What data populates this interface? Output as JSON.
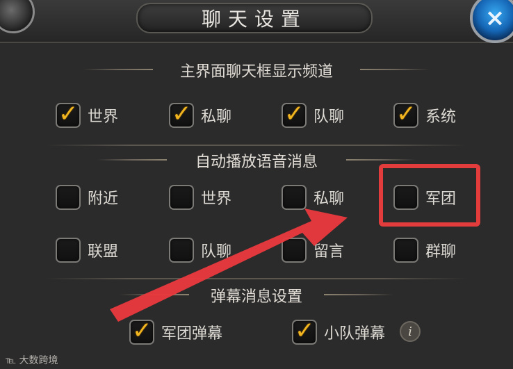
{
  "window": {
    "title": "聊天设置",
    "close_icon": "×"
  },
  "sections": {
    "main_channels": {
      "title": "主界面聊天框显示频道",
      "options": [
        {
          "label": "世界",
          "checked": true
        },
        {
          "label": "私聊",
          "checked": true
        },
        {
          "label": "队聊",
          "checked": true
        },
        {
          "label": "系统",
          "checked": true
        }
      ]
    },
    "auto_voice": {
      "title": "自动播放语音消息",
      "options": [
        {
          "label": "附近",
          "checked": false
        },
        {
          "label": "世界",
          "checked": false
        },
        {
          "label": "私聊",
          "checked": false
        },
        {
          "label": "军团",
          "checked": false
        },
        {
          "label": "联盟",
          "checked": false
        },
        {
          "label": "队聊",
          "checked": false
        },
        {
          "label": "留言",
          "checked": false
        },
        {
          "label": "群聊",
          "checked": false
        }
      ]
    },
    "barrage": {
      "title": "弹幕消息设置",
      "options": [
        {
          "label": "军团弹幕",
          "checked": true
        },
        {
          "label": "小队弹幕",
          "checked": true
        }
      ],
      "info_icon": "i"
    }
  },
  "annotation": {
    "highlight_color": "#e23c3c",
    "highlighted_option": "军团"
  },
  "watermark": "大数跨境",
  "colors": {
    "check": "#f0b51f",
    "panel_bg": "#2b2b2b",
    "close_button": "#1566b5"
  }
}
